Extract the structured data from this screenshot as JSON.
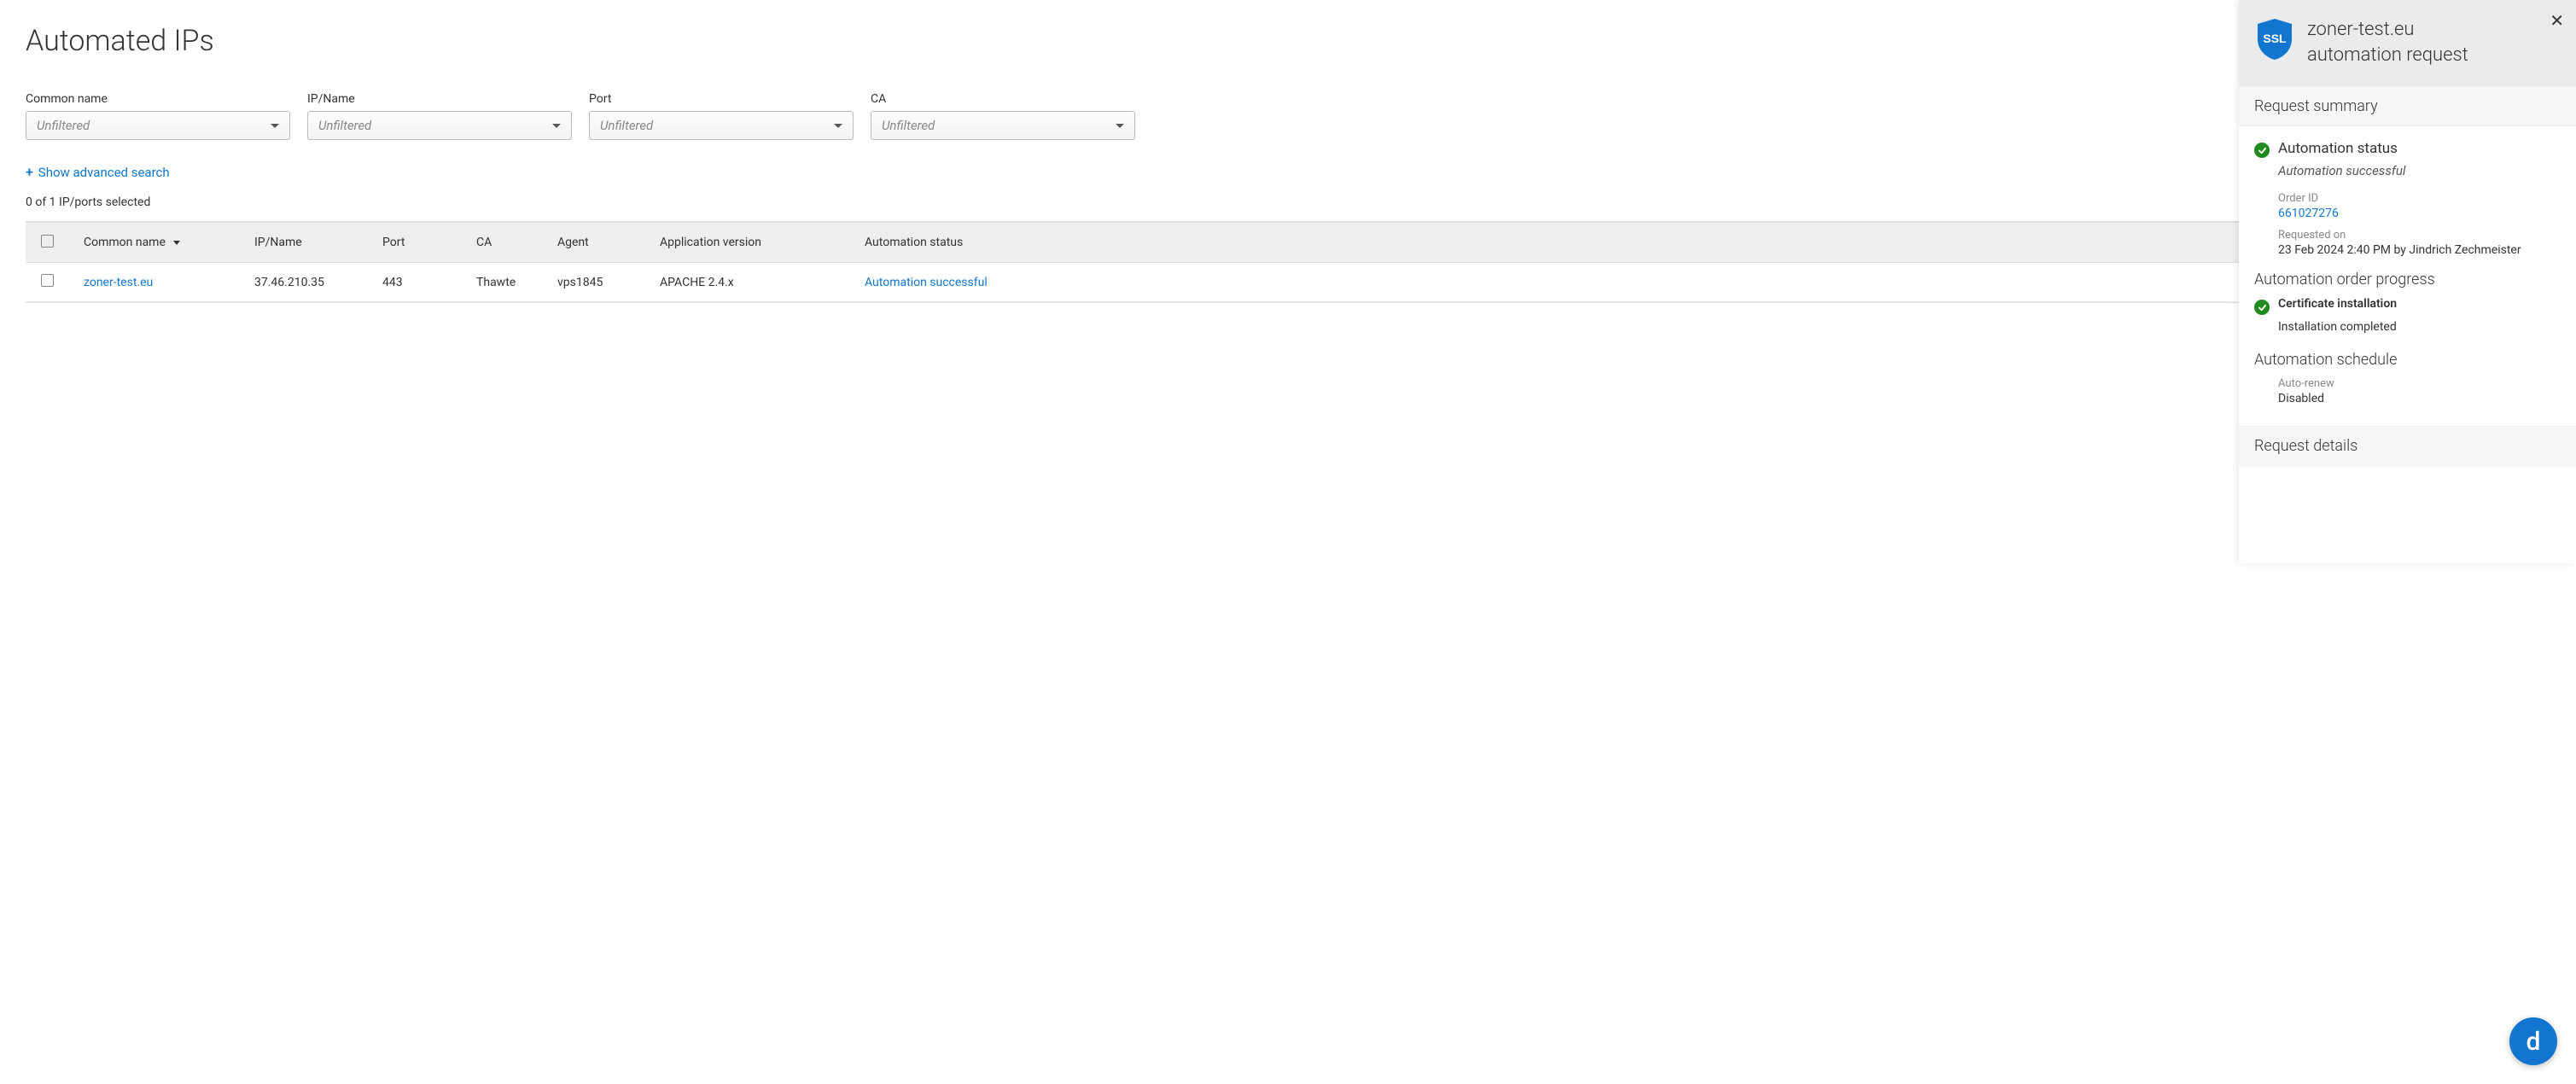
{
  "page": {
    "title": "Automated IPs",
    "selected_text": "0 of 1 IP/ports selected",
    "advanced_search": "Show advanced search"
  },
  "filters": [
    {
      "label": "Common name",
      "placeholder": "Unfiltered"
    },
    {
      "label": "IP/Name",
      "placeholder": "Unfiltered"
    },
    {
      "label": "Port",
      "placeholder": "Unfiltered"
    },
    {
      "label": "CA",
      "placeholder": "Unfiltered"
    }
  ],
  "table": {
    "columns": {
      "common_name": "Common name",
      "ip_name": "IP/Name",
      "port": "Port",
      "ca": "CA",
      "agent": "Agent",
      "app_version": "Application version",
      "automation_status": "Automation status"
    },
    "rows": [
      {
        "common_name": "zoner-test.eu",
        "ip_name": "37.46.210.35",
        "port": "443",
        "ca": "Thawte",
        "agent": "vps1845",
        "app_version": "APACHE 2.4.x",
        "automation_status": "Automation successful"
      }
    ]
  },
  "panel": {
    "title_line1": "zoner-test.eu",
    "title_line2": "automation request",
    "summary_label": "Request summary",
    "status_title": "Automation status",
    "status_sub": "Automation successful",
    "order_id_label": "Order ID",
    "order_id": "661027276",
    "requested_label": "Requested on",
    "requested_val": "23 Feb 2024 2:40 PM by Jindrich Zechmeister",
    "progress_label": "Automation order progress",
    "cert_install_title": "Certificate installation",
    "cert_install_sub": "Installation completed",
    "schedule_label": "Automation schedule",
    "autorenew_label": "Auto-renew",
    "autorenew_val": "Disabled",
    "details_label": "Request details"
  },
  "fab": {
    "letter": "d"
  }
}
